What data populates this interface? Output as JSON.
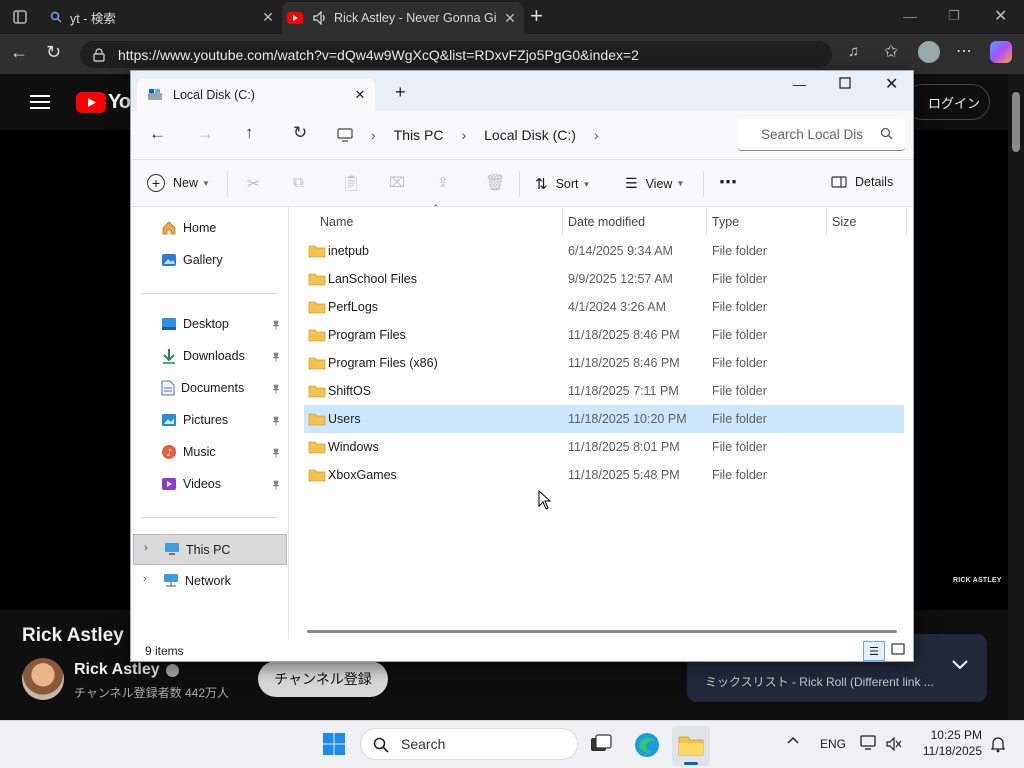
{
  "browser": {
    "tabs": [
      {
        "title": "yt - 検索"
      },
      {
        "title": "Rick Astley - Never Gonna Gi"
      }
    ],
    "url": "https://www.youtube.com/watch?v=dQw4w9WgXcQ&list=RDxvFZjo5PgG0&index=2"
  },
  "youtube": {
    "logo_text": "You",
    "login_label": "ログイン",
    "watermark": "RICK ASTLEY",
    "video_title": "Rick Astley",
    "channel_name": "Rick Astley",
    "subscribers": "チャンネル登録者数 442万人",
    "subscribe_label": "チャンネル登録",
    "mix_text": "ミックスリスト - Rick Roll (Different link ..."
  },
  "explorer": {
    "tab_title": "Local Disk (C:)",
    "breadcrumb": [
      "This PC",
      "Local Disk (C:)"
    ],
    "search_placeholder": "Search Local Dis",
    "commands": {
      "new": "New",
      "sort": "Sort",
      "view": "View",
      "details": "Details"
    },
    "sidebar": {
      "top": [
        {
          "label": "Home",
          "icon": "home-icon"
        },
        {
          "label": "Gallery",
          "icon": "gallery-icon"
        }
      ],
      "pinned": [
        {
          "label": "Desktop",
          "icon": "desktop-icon"
        },
        {
          "label": "Downloads",
          "icon": "downloads-icon"
        },
        {
          "label": "Documents",
          "icon": "documents-icon"
        },
        {
          "label": "Pictures",
          "icon": "pictures-icon"
        },
        {
          "label": "Music",
          "icon": "music-icon"
        },
        {
          "label": "Videos",
          "icon": "videos-icon"
        }
      ],
      "bottom": [
        {
          "label": "This PC",
          "icon": "this-pc-icon",
          "selected": true
        },
        {
          "label": "Network",
          "icon": "network-icon"
        }
      ]
    },
    "columns": {
      "name": "Name",
      "date": "Date modified",
      "type": "Type",
      "size": "Size"
    },
    "files": [
      {
        "name": "inetpub",
        "date": "6/14/2025 9:34 AM",
        "type": "File folder"
      },
      {
        "name": "LanSchool Files",
        "date": "9/9/2025 12:57 AM",
        "type": "File folder"
      },
      {
        "name": "PerfLogs",
        "date": "4/1/2024 3:26 AM",
        "type": "File folder"
      },
      {
        "name": "Program Files",
        "date": "11/18/2025 8:46 PM",
        "type": "File folder"
      },
      {
        "name": "Program Files (x86)",
        "date": "11/18/2025 8:46 PM",
        "type": "File folder"
      },
      {
        "name": "ShiftOS",
        "date": "11/18/2025 7:11 PM",
        "type": "File folder"
      },
      {
        "name": "Users",
        "date": "11/18/2025 10:20 PM",
        "type": "File folder",
        "selected": true
      },
      {
        "name": "Windows",
        "date": "11/18/2025 8:01 PM",
        "type": "File folder"
      },
      {
        "name": "XboxGames",
        "date": "11/18/2025 5:48 PM",
        "type": "File folder"
      }
    ],
    "status": "9 items"
  },
  "taskbar": {
    "search_label": "Search",
    "language": "ENG",
    "time": "10:25 PM",
    "date": "11/18/2025"
  },
  "colors": {
    "folder": "#f2c14e",
    "selection": "#cce8ff",
    "youtube_red": "#ff0000",
    "accent": "#0067c0"
  }
}
